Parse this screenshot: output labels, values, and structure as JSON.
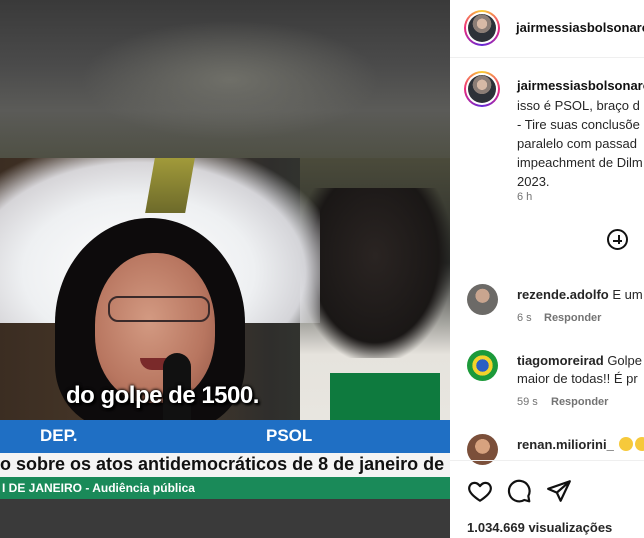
{
  "video": {
    "caption": "do golpe de 1500.",
    "banner_label": "DEP.",
    "banner_party": "PSOL",
    "banner_ticker": "o sobre os atos antidemocráticos de 8 de janeiro de",
    "banner_location": "I DE JANEIRO - Audiência pública"
  },
  "post": {
    "header_username": "jairmessiasbolsonaro",
    "author_username": "jairmessiasbolsonaro",
    "text_lines": [
      "isso é PSOL, braço d",
      "- Tire suas conclusõe",
      "paralelo com passad",
      "impeachment de Dilm",
      "2023."
    ],
    "time_ago": "6 h"
  },
  "comments": [
    {
      "username": "rezende.adolfo",
      "text": "E um",
      "time": "6 s",
      "reply_label": "Responder"
    },
    {
      "username": "tiagomoreirad",
      "text": "Golpe",
      "text_line2": "maior de todas!! É pr",
      "time": "59 s",
      "reply_label": "Responder"
    },
    {
      "username": "renan.miliorini_",
      "text": ""
    }
  ],
  "footer": {
    "views": "1.034.669 visualizações"
  },
  "icons": {
    "add_comment": "plus-circle-icon",
    "like": "heart-icon",
    "comment": "comment-icon",
    "share": "send-icon"
  }
}
